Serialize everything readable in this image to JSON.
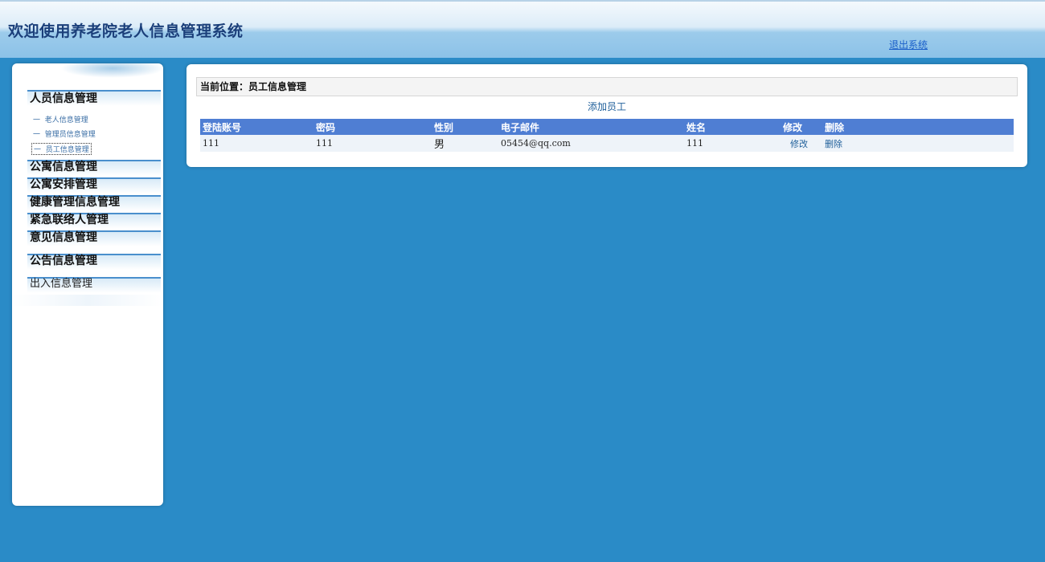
{
  "header": {
    "title": "欢迎使用养老院老人信息管理系统",
    "logout_label": "退出系统"
  },
  "sidebar": {
    "groups": [
      {
        "label": "人员信息管理",
        "items": [
          {
            "label": "老人信息管理",
            "prefix": "一"
          },
          {
            "label": "管理员信息管理",
            "prefix": "一"
          },
          {
            "label": "员工信息管理",
            "prefix": "一",
            "active": true
          }
        ]
      },
      {
        "label": "公寓信息管理"
      },
      {
        "label": "公寓安排管理"
      },
      {
        "label": "健康管理信息管理"
      },
      {
        "label": "紧急联络人管理"
      },
      {
        "label": "意见信息管理"
      },
      {
        "label": "公告信息管理"
      },
      {
        "label": "出入信息管理"
      }
    ]
  },
  "main": {
    "breadcrumb": "当前位置：员工信息管理",
    "add_label": "添加员工",
    "table": {
      "headers": [
        "登陆账号",
        "密码",
        "性别",
        "电子邮件",
        "姓名",
        "修改",
        "删除"
      ],
      "rows": [
        {
          "account": "111",
          "password": "111",
          "gender": "男",
          "email": "05454@qq.com",
          "name": "111",
          "edit": "修改",
          "delete": "删除"
        }
      ]
    }
  },
  "colors": {
    "background": "#2a8bc7",
    "table_header": "#4f7ed3",
    "link": "#1f5f9a"
  }
}
